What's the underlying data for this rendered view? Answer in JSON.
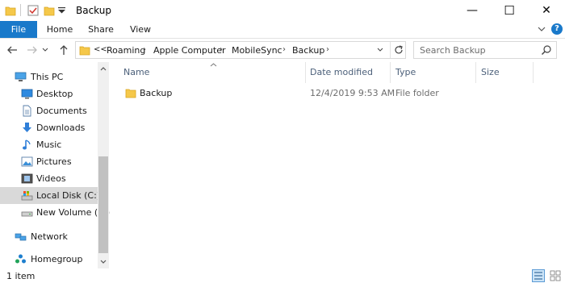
{
  "window": {
    "title": "Backup",
    "controls": {
      "minimize": "—",
      "maximize": "☐",
      "close": "✕"
    }
  },
  "ribbon": {
    "tabs": [
      {
        "label": "File",
        "active": true
      },
      {
        "label": "Home"
      },
      {
        "label": "Share"
      },
      {
        "label": "View"
      }
    ],
    "help": "?"
  },
  "address": {
    "overflow": "<<",
    "breadcrumbs": [
      "Roaming",
      "Apple Computer",
      "MobileSync",
      "Backup"
    ],
    "search_placeholder": "Search Backup"
  },
  "nav_pane": {
    "items": [
      {
        "label": "This PC",
        "icon": "this-pc-icon",
        "top": true
      },
      {
        "label": "Desktop",
        "icon": "desktop-icon"
      },
      {
        "label": "Documents",
        "icon": "documents-icon"
      },
      {
        "label": "Downloads",
        "icon": "downloads-icon"
      },
      {
        "label": "Music",
        "icon": "music-icon"
      },
      {
        "label": "Pictures",
        "icon": "pictures-icon"
      },
      {
        "label": "Videos",
        "icon": "videos-icon"
      },
      {
        "label": "Local Disk (C:)",
        "icon": "local-disk-icon",
        "selected": true
      },
      {
        "label": "New Volume (E:)",
        "icon": "volume-icon"
      },
      {
        "label": "Network",
        "icon": "network-icon",
        "top": true
      },
      {
        "label": "Homegroup",
        "icon": "homegroup-icon",
        "top": true
      }
    ]
  },
  "content": {
    "columns": [
      "Name",
      "Date modified",
      "Type",
      "Size"
    ],
    "rows": [
      {
        "name": "Backup",
        "date": "12/4/2019 9:53 AM",
        "type": "File folder",
        "size": ""
      }
    ]
  },
  "status": {
    "count": "1 item"
  },
  "colors": {
    "accent": "#1979ca",
    "folder": "#f5c84a",
    "selected": "#d9d9d9"
  }
}
